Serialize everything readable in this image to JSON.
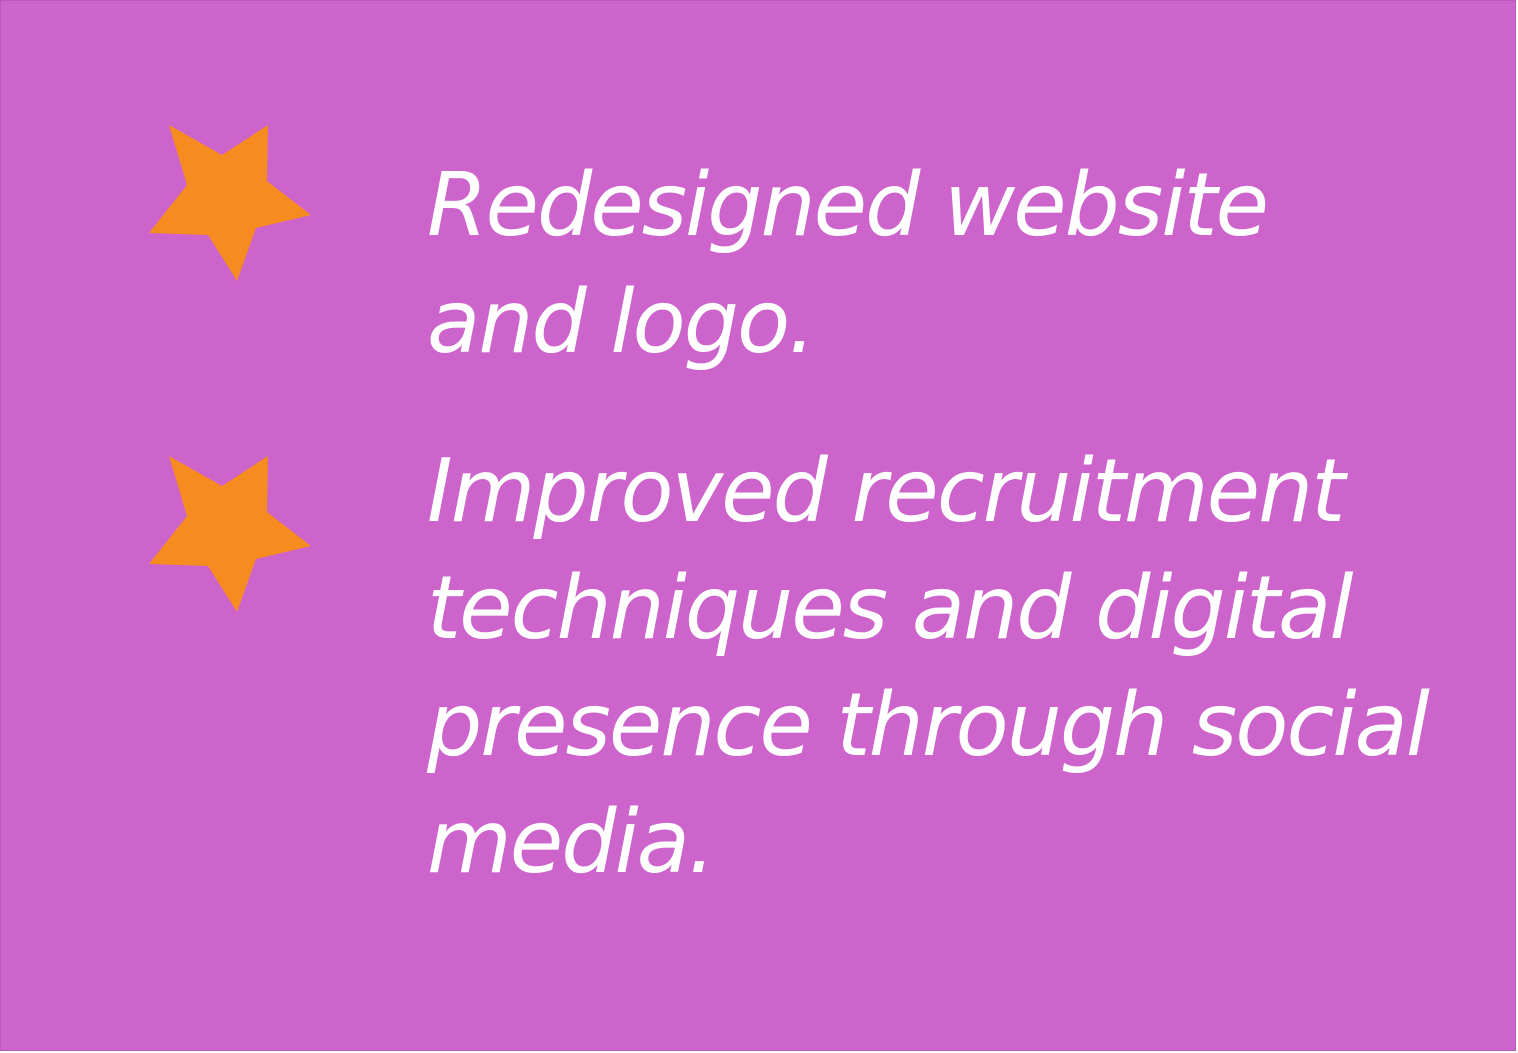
{
  "accomplishments": [
    {
      "icon": "star-icon",
      "text": "Redesigned website\nand logo."
    },
    {
      "icon": "star-icon",
      "text": "Improved recruitment\ntechniques and digital\npresence through social\nmedia."
    }
  ],
  "colors": {
    "background": "#cd64cc",
    "star": "#f68b20",
    "text": "#ffffff"
  }
}
